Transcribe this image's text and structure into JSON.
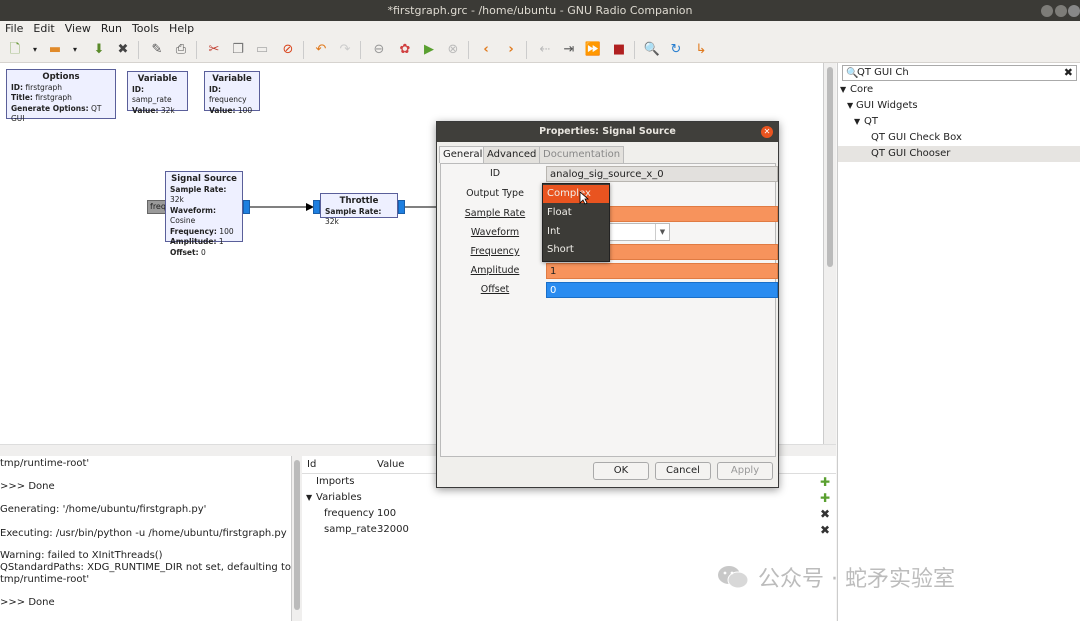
{
  "window": {
    "title": "*firstgraph.grc - /home/ubuntu - GNU Radio Companion"
  },
  "menu": [
    "File",
    "Edit",
    "View",
    "Run",
    "Tools",
    "Help"
  ],
  "toolbar": [
    "new-icon",
    "dropdown-icon",
    "open-icon",
    "dropdown-icon",
    "save-icon",
    "close-icon",
    "edit-icon",
    "print-icon",
    "cut-icon",
    "copy-icon",
    "paste-icon",
    "delete-icon",
    "undo-icon",
    "redo-icon",
    "disable-icon",
    "generate-icon",
    "run-icon",
    "stop-icon",
    "rotate-left-icon",
    "rotate-right-icon",
    "bypass-icon",
    "hier-icon",
    "forward-icon",
    "kill-icon",
    "find-icon",
    "reload-icon",
    "more-icon"
  ],
  "canvas": {
    "blocks": {
      "options": {
        "title": "Options",
        "params": [
          [
            "ID:",
            "firstgraph"
          ],
          [
            "Title:",
            "firstgraph"
          ],
          [
            "Generate Options:",
            "QT GUI"
          ]
        ]
      },
      "var_samp": {
        "title": "Variable",
        "params": [
          [
            "ID:",
            "samp_rate"
          ],
          [
            "Value:",
            "32k"
          ]
        ]
      },
      "var_freq": {
        "title": "Variable",
        "params": [
          [
            "ID:",
            "frequency"
          ],
          [
            "Value:",
            "100"
          ]
        ]
      },
      "signal_source": {
        "title": "Signal Source",
        "params": [
          [
            "Sample Rate:",
            "32k"
          ],
          [
            "Waveform:",
            "Cosine"
          ],
          [
            "Frequency:",
            "100"
          ],
          [
            "Amplitude:",
            "1"
          ],
          [
            "Offset:",
            "0"
          ]
        ]
      },
      "throttle": {
        "title": "Throttle",
        "params": [
          [
            "Sample Rate:",
            "32k"
          ]
        ]
      }
    },
    "freq_port": "freq"
  },
  "library": {
    "search_value": "QT GUI Ch",
    "tree": [
      {
        "label": "Core",
        "arrow": "▼"
      },
      {
        "label": "GUI Widgets",
        "arrow": "▼"
      },
      {
        "label": "QT",
        "arrow": "▼"
      },
      {
        "label": "QT GUI Check Box",
        "arrow": ""
      },
      {
        "label": "QT GUI Chooser",
        "arrow": ""
      }
    ]
  },
  "console": {
    "lines": [
      "tmp/runtime-root'",
      ">>> Done",
      "Generating: '/home/ubuntu/firstgraph.py'",
      "Executing: /usr/bin/python -u /home/ubuntu/firstgraph.py",
      "Warning: failed to XInitThreads()",
      "QStandardPaths: XDG_RUNTIME_DIR not set, defaulting to '/",
      "tmp/runtime-root'",
      ">>> Done"
    ]
  },
  "variables": {
    "headers": {
      "id": "Id",
      "value": "Value"
    },
    "rows": [
      {
        "id": "Imports",
        "value": "",
        "arrow": ""
      },
      {
        "id": "Variables",
        "value": "",
        "arrow": "▼"
      },
      {
        "id": "frequency",
        "value": "100",
        "arrow": ""
      },
      {
        "id": "samp_rate",
        "value": "32000",
        "arrow": ""
      }
    ]
  },
  "dialog": {
    "title": "Properties: Signal Source",
    "tabs": [
      "General",
      "Advanced",
      "Documentation"
    ],
    "labels": {
      "id": "ID",
      "output_type": "Output Type",
      "sample_rate": "Sample Rate",
      "waveform": "Waveform",
      "frequency": "Frequency",
      "amplitude": "Amplitude",
      "offset": "Offset"
    },
    "values": {
      "id": "analog_sig_source_x_0",
      "amplitude": "1",
      "offset": "0"
    },
    "buttons": {
      "ok": "OK",
      "cancel": "Cancel",
      "apply": "Apply"
    },
    "colors": {
      "orange": "#f7935c",
      "blue": "#2a8cf0",
      "selection": "#e95420"
    }
  },
  "dropdown": {
    "options": [
      "Complex",
      "Float",
      "Int",
      "Short"
    ],
    "selected": "Complex"
  },
  "watermark": {
    "text": "公众号 · 蛇矛实验室"
  }
}
